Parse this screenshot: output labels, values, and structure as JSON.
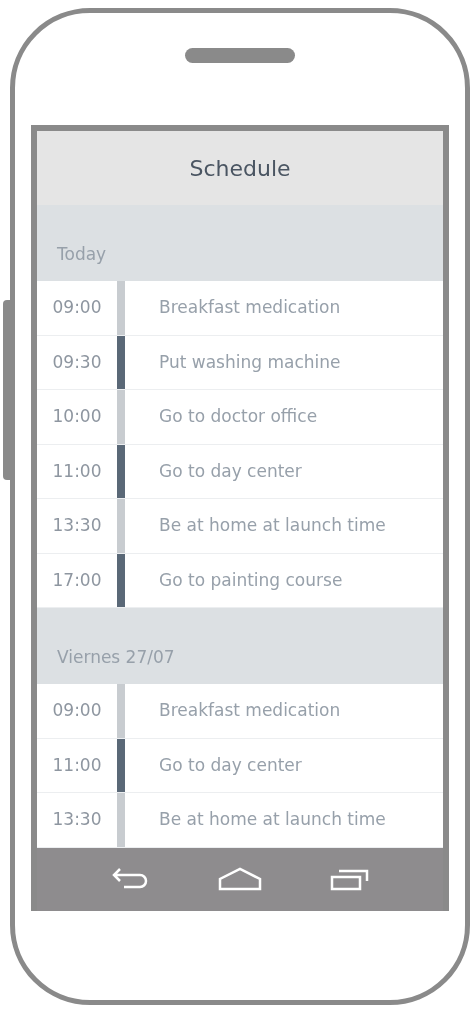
{
  "app_bar": {
    "title": "Schedule"
  },
  "sections": [
    {
      "header": "Today",
      "events": [
        {
          "time": "09:00",
          "title": "Breakfast medication",
          "color": "#c8ccd0"
        },
        {
          "time": "09:30",
          "title": "Put washing machine",
          "color": "#5a6877"
        },
        {
          "time": "10:00",
          "title": "Go to doctor office",
          "color": "#c8ccd0"
        },
        {
          "time": "11:00",
          "title": "Go to day center",
          "color": "#5a6877"
        },
        {
          "time": "13:30",
          "title": "Be at home at launch time",
          "color": "#c8ccd0"
        },
        {
          "time": "17:00",
          "title": "Go to painting course",
          "color": "#5a6877"
        }
      ]
    },
    {
      "header": "Viernes 27/07",
      "events": [
        {
          "time": "09:00",
          "title": "Breakfast medication",
          "color": "#c8ccd0"
        },
        {
          "time": "11:00",
          "title": "Go to day center",
          "color": "#5a6877"
        },
        {
          "time": "13:30",
          "title": "Be at home at launch time",
          "color": "#c8ccd0"
        }
      ]
    }
  ]
}
